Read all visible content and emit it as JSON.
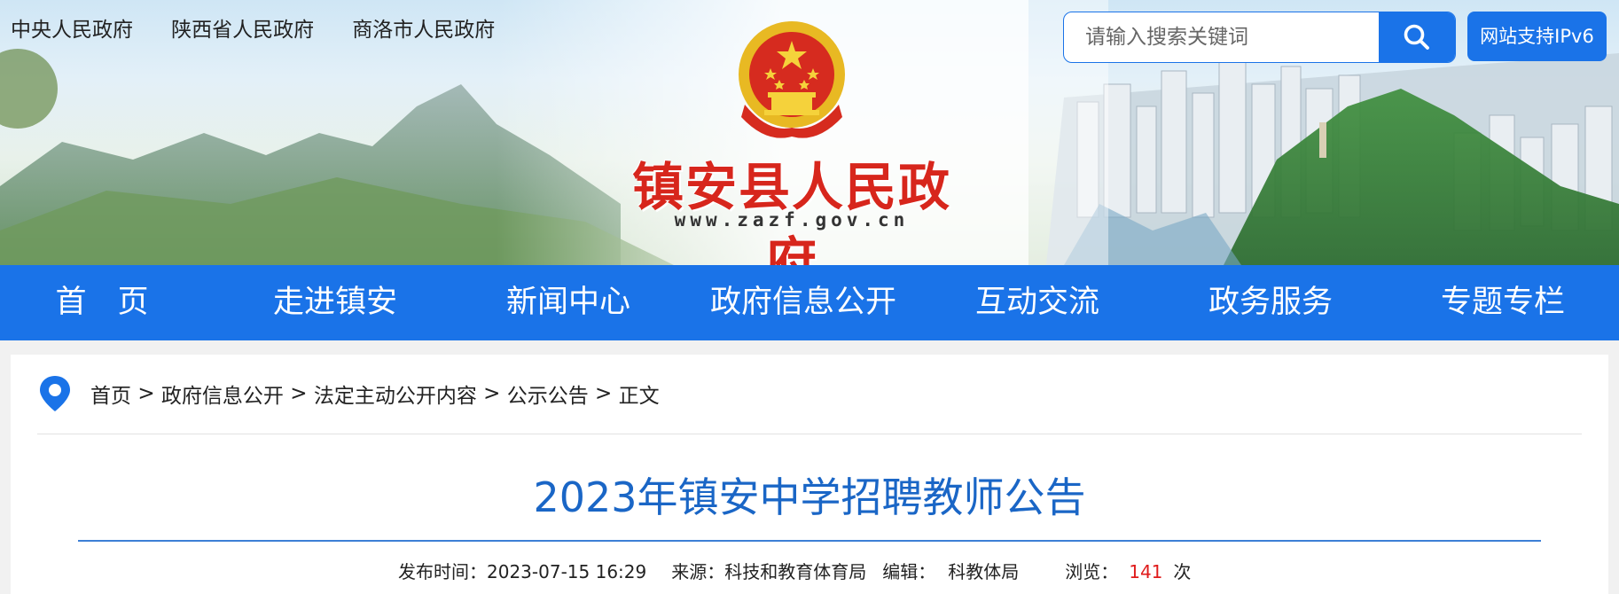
{
  "top_links": [
    "中央人民政府",
    "陕西省人民政府",
    "商洛市人民政府"
  ],
  "search": {
    "placeholder": "请输入搜索关键词",
    "icon": "search-icon"
  },
  "ipv6_badge": "网站支持IPv6",
  "site": {
    "name": "镇安县人民政府",
    "url": "www.zazf.gov.cn"
  },
  "nav": [
    "首　页",
    "走进镇安",
    "新闻中心",
    "政府信息公开",
    "互动交流",
    "政务服务",
    "专题专栏"
  ],
  "breadcrumb": {
    "icon": "location-pin-icon",
    "items": [
      "首页",
      "政府信息公开",
      "法定主动公开内容",
      "公示公告",
      "正文"
    ],
    "separator": ">"
  },
  "article": {
    "title": "2023年镇安中学招聘教师公告",
    "publish_label": "发布时间：",
    "publish_time": "2023-07-15 16:29",
    "source_label": "来源：",
    "source": "科技和教育体育局",
    "editor_label": "编辑：",
    "editor": "科教体局",
    "views_label": "浏览：",
    "views": "141",
    "views_unit": "次"
  },
  "colors": {
    "brand_blue": "#1a73e8",
    "title_blue": "#1a66c6",
    "site_red": "#d7261c",
    "views_red": "#e01b1b"
  }
}
